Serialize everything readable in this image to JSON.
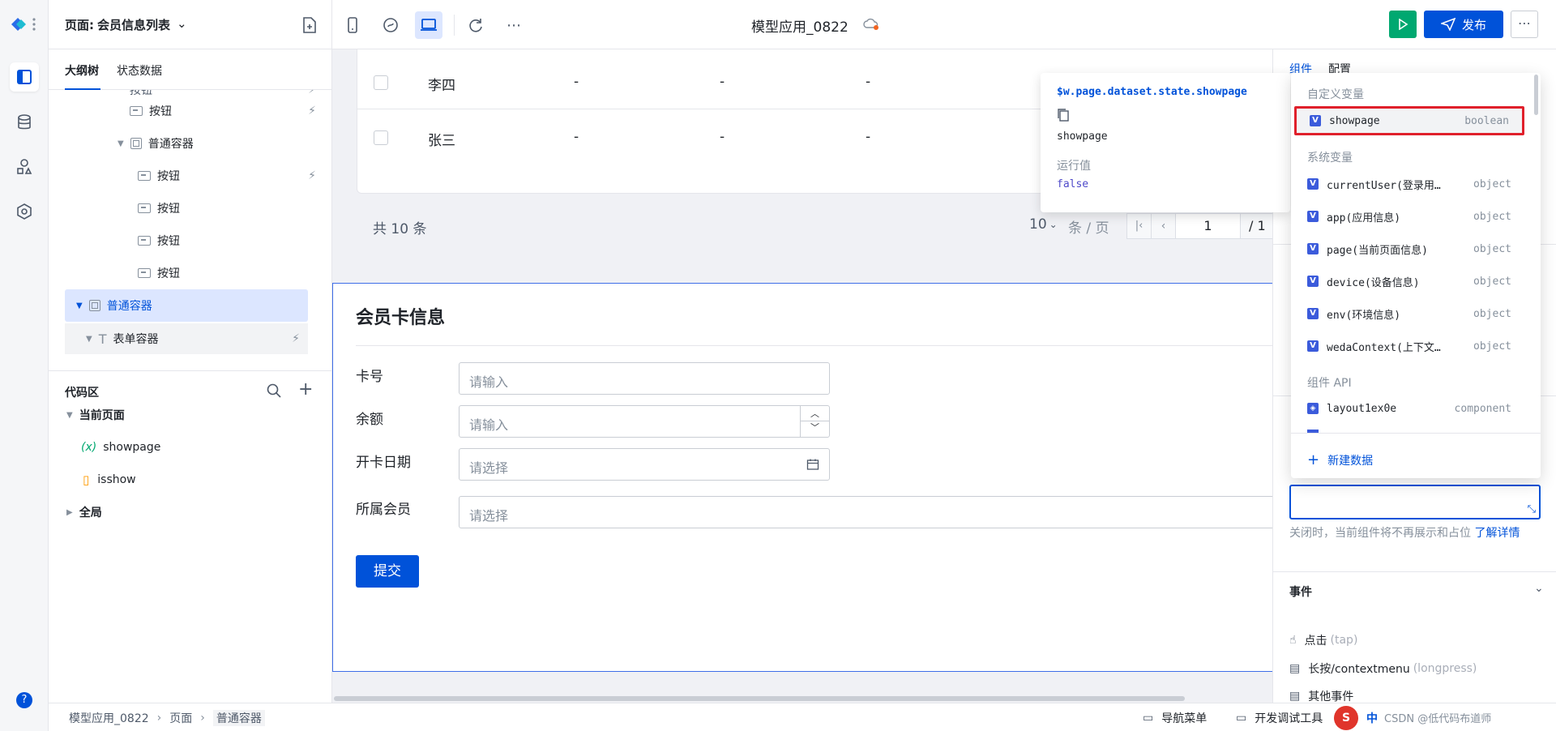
{
  "topbar": {
    "page_prefix": "页面:",
    "page_name": "会员信息列表",
    "app_title": "模型应用_0822",
    "publish_label": "发布",
    "more_label": "⋯"
  },
  "left_panel": {
    "tabs": [
      "大纲树",
      "状态数据"
    ],
    "tree": {
      "partial": "按钮",
      "items": [
        "按钮",
        "普通容器",
        "按钮",
        "按钮",
        "按钮",
        "按钮",
        "普通容器",
        "表单容器"
      ]
    },
    "code": {
      "title": "代码区",
      "current_page": "当前页面",
      "var_label": "showpage",
      "var_prefix": "(x)",
      "handler_label": "isshow",
      "global_label": "全局"
    }
  },
  "table": {
    "rows": [
      {
        "name": "李四",
        "c1": "-",
        "c2": "-",
        "c3": "-"
      },
      {
        "name": "张三",
        "c1": "-",
        "c2": "-",
        "c3": "-"
      }
    ],
    "total_text": "共 10 条",
    "page_size": "10",
    "per_page_label": "条 / 页",
    "current_page": "1",
    "total_pages": "/ 1"
  },
  "form": {
    "title": "会员卡信息",
    "fields": [
      {
        "label": "卡号",
        "placeholder": "请输入"
      },
      {
        "label": "余额",
        "placeholder": "请输入"
      },
      {
        "label": "开卡日期",
        "placeholder": "请选择"
      },
      {
        "label": "所属会员",
        "placeholder": "请选择"
      }
    ],
    "submit_label": "提交"
  },
  "right_panel": {
    "tabs": [
      "组件",
      "配置"
    ],
    "hint_text": "关闭时，当前组件将不再展示和占位",
    "hint_link": "了解详情",
    "events_title": "事件",
    "events": [
      {
        "name": "点击",
        "code": "(tap)"
      },
      {
        "name": "长按/contextmenu",
        "code": "(longpress)"
      },
      {
        "name": "其他事件",
        "code": ""
      }
    ]
  },
  "tooltip": {
    "path": "$w.page.dataset.state.showpage",
    "name": "showpage",
    "runtime_label": "运行值",
    "runtime_value": "false"
  },
  "dropdown": {
    "groups": {
      "custom": "自定义变量",
      "system": "系统变量",
      "api": "组件 API"
    },
    "custom_vars": [
      {
        "name": "showpage",
        "type": "boolean"
      }
    ],
    "system_vars": [
      {
        "name": "currentUser(登录用…",
        "type": "object"
      },
      {
        "name": "app(应用信息)",
        "type": "object"
      },
      {
        "name": "page(当前页面信息)",
        "type": "object"
      },
      {
        "name": "device(设备信息)",
        "type": "object"
      },
      {
        "name": "env(环境信息)",
        "type": "object"
      },
      {
        "name": "wedaContext(上下文…",
        "type": "object"
      }
    ],
    "api_vars": [
      {
        "name": "layout1ex0e",
        "type": "component"
      }
    ],
    "new_data_label": "新建数据"
  },
  "statusbar": {
    "breadcrumb": [
      "模型应用_0822",
      "页面",
      "普通容器"
    ],
    "nav_menu": "导航菜单",
    "debug_tools": "开发调试工具",
    "ime_label": "中",
    "watermark": "CSDN @低代码布道师"
  },
  "colors": {
    "primary": "#0052d9",
    "run_green": "#00a870",
    "highlight_red": "#e0202b",
    "selected_row": "#dce6ff"
  }
}
